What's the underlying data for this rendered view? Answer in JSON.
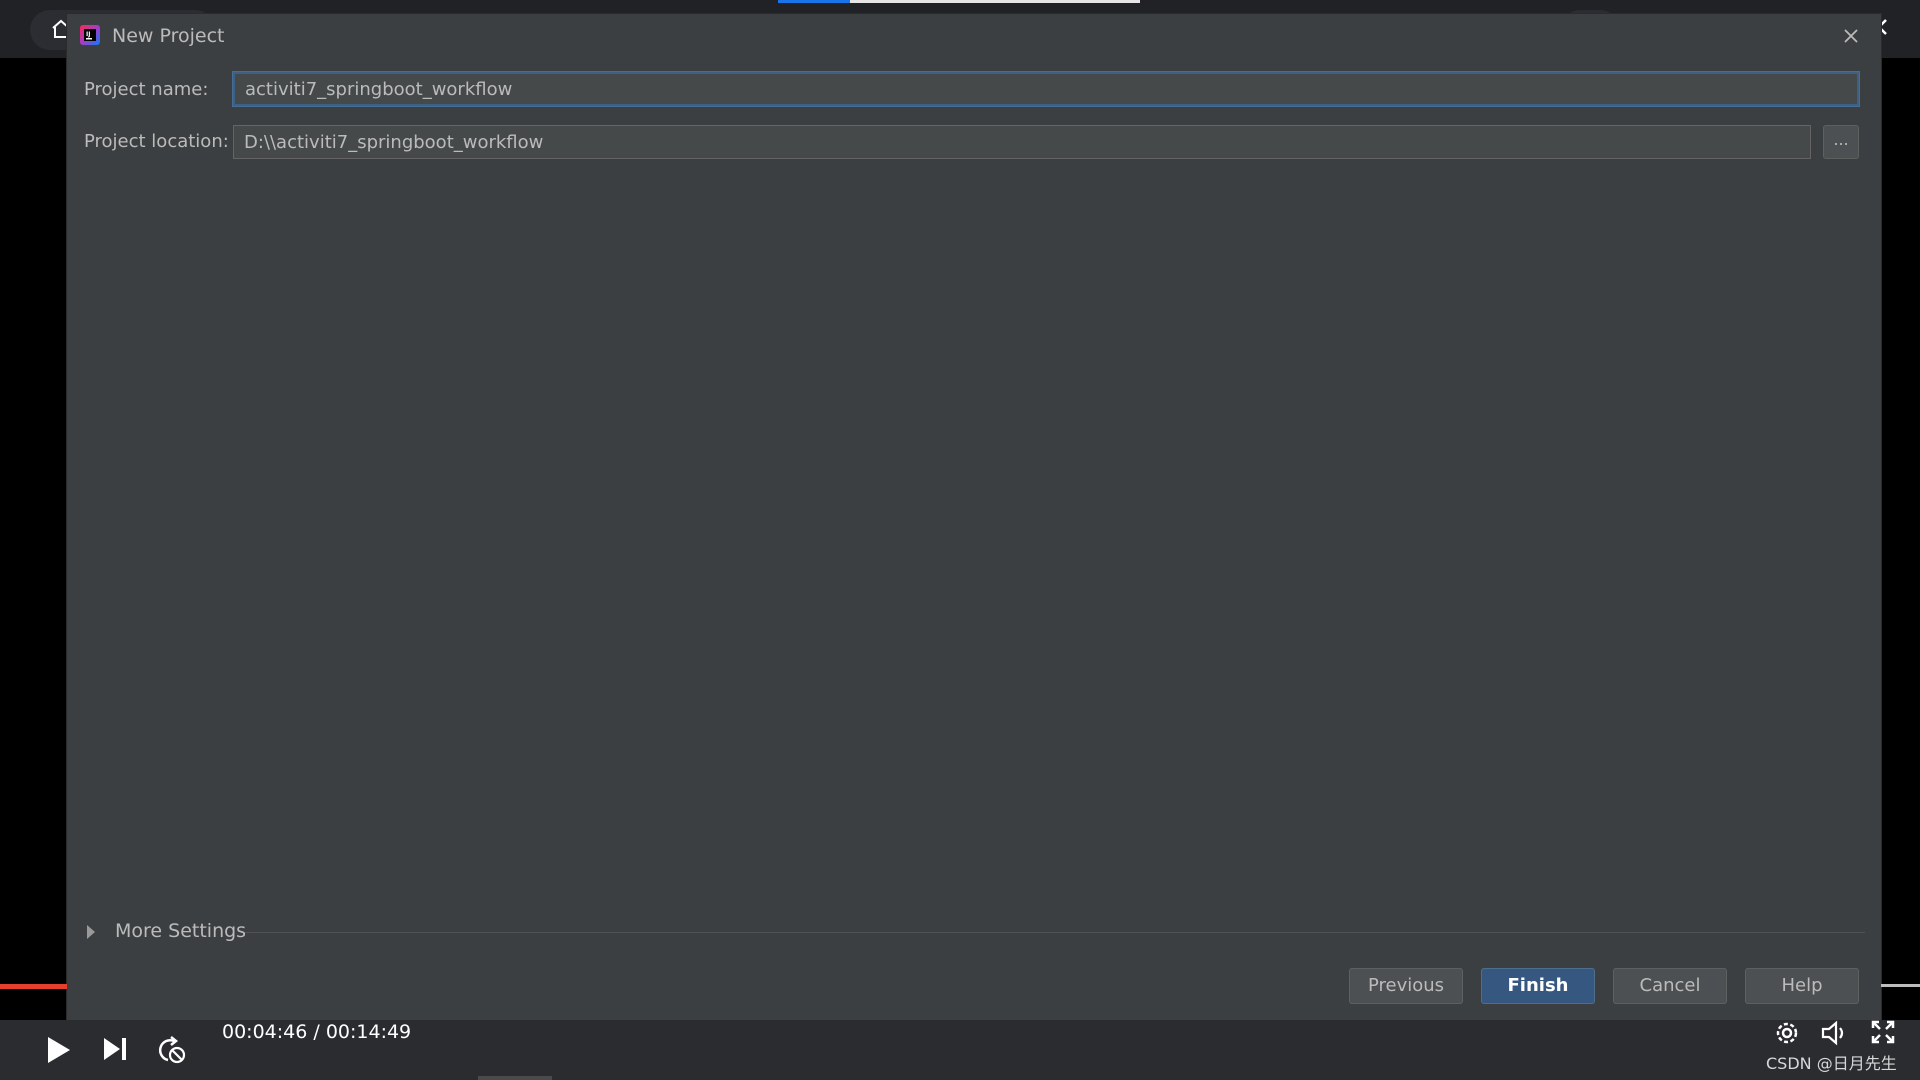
{
  "dialog": {
    "title": "New Project",
    "icon": "intellij-idea-icon",
    "close_icon": "close-icon"
  },
  "form": {
    "project_name_label": "Project name:",
    "project_name_value": "activiti7_springboot_workflow",
    "project_location_label": "Project location:",
    "project_location_value": "D:\\\\activiti7_springboot_workflow",
    "browse_label": "..."
  },
  "more_settings": {
    "label": "More Settings",
    "expanded": false
  },
  "buttons": {
    "previous": "Previous",
    "finish": "Finish",
    "cancel": "Cancel",
    "help": "Help"
  },
  "player": {
    "time": "00:04:46 / 00:14:49",
    "watermark": "CSDN @日月先生",
    "icons": [
      "play-icon",
      "next-icon",
      "loop-icon",
      "settings-icon",
      "volume-icon",
      "fullscreen-icon"
    ]
  },
  "colors": {
    "dialog_bg": "#3c3f41",
    "field_bg": "#45494a",
    "focus_border": "#3d6185",
    "primary_button": "#365880",
    "progress_red": "#e5402b"
  }
}
